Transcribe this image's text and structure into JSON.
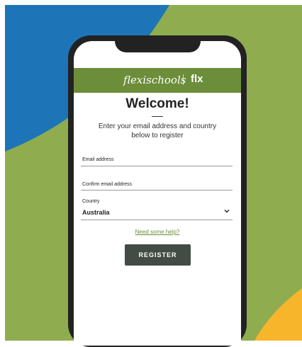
{
  "brand": {
    "name": "flexischools",
    "mark": "flx"
  },
  "form": {
    "title": "Welcome!",
    "intro": "Enter your email address and country below to register",
    "email_label": "Email address",
    "confirm_email_label": "Confirm email address",
    "country_label": "Country",
    "country_value": "Australia",
    "help_link": "Need some help?",
    "register_button": "REGISTER"
  },
  "colors": {
    "background_green": "#8fac4f",
    "blue_shape": "#1d75b8",
    "yellow_shape": "#f7b52c",
    "brand_green": "#6c8d3a",
    "button": "#434c44"
  },
  "icons": {
    "country_dropdown": "chevron-down-icon"
  }
}
